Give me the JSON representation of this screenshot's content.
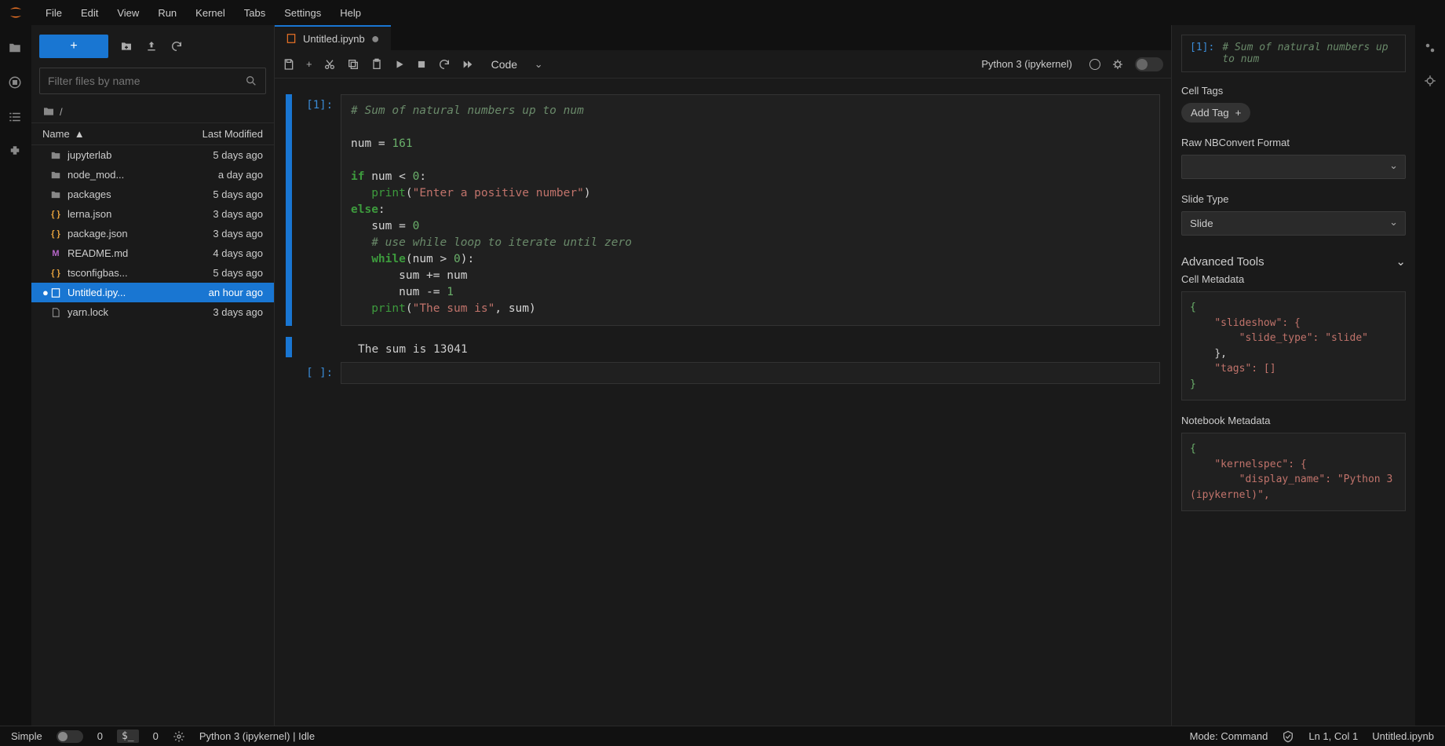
{
  "menubar": [
    "File",
    "Edit",
    "View",
    "Run",
    "Kernel",
    "Tabs",
    "Settings",
    "Help"
  ],
  "filter_placeholder": "Filter files by name",
  "breadcrumb_root": "/",
  "file_header": {
    "name": "Name",
    "modified": "Last Modified"
  },
  "files": [
    {
      "icon": "folder",
      "name": "jupyterlab",
      "modified": "5 days ago"
    },
    {
      "icon": "folder",
      "name": "node_mod...",
      "modified": "a day ago"
    },
    {
      "icon": "folder",
      "name": "packages",
      "modified": "5 days ago"
    },
    {
      "icon": "json",
      "name": "lerna.json",
      "modified": "3 days ago"
    },
    {
      "icon": "json",
      "name": "package.json",
      "modified": "3 days ago"
    },
    {
      "icon": "md",
      "name": "README.md",
      "modified": "4 days ago"
    },
    {
      "icon": "json",
      "name": "tsconfigbas...",
      "modified": "5 days ago"
    },
    {
      "icon": "nb",
      "name": "Untitled.ipy...",
      "modified": "an hour ago",
      "selected": true,
      "dirty": true
    },
    {
      "icon": "file",
      "name": "yarn.lock",
      "modified": "3 days ago"
    }
  ],
  "tab": {
    "title": "Untitled.ipynb"
  },
  "celltype": "Code",
  "kernel": "Python 3 (ipykernel)",
  "cells": {
    "c1_prompt": "[1]:",
    "c1_output": "The sum is 13041",
    "c2_prompt": "[ ]:"
  },
  "code": {
    "l1": "# Sum of natural numbers up to num",
    "l2_var": "num ",
    "l2_op": "= ",
    "l2_num": "161",
    "l3_if": "if",
    "l3_cond": " num ",
    "l3_op": "<",
    "l3_sp": " ",
    "l3_zero": "0",
    "l3_colon": ":",
    "l4_indent": "   ",
    "l4_print": "print",
    "l4_paren": "(",
    "l4_str": "\"Enter a positive number\"",
    "l4_close": ")",
    "l5_else": "else",
    "l5_colon": ":",
    "l6_indent": "   ",
    "l6_sum": "sum ",
    "l6_op": "= ",
    "l6_zero": "0",
    "l7_indent": "   ",
    "l7_comment": "# use while loop to iterate until zero",
    "l8_indent": "   ",
    "l8_while": "while",
    "l8_paren": "(num ",
    "l8_op": ">",
    "l8_sp": " ",
    "l8_zero": "0",
    "l8_close": "):",
    "l9_indent": "       ",
    "l9_sum": "sum ",
    "l9_op": "+= ",
    "l9_var": "num",
    "l10_indent": "       ",
    "l10_num": "num ",
    "l10_op": "-= ",
    "l10_one": "1",
    "l11_indent": "   ",
    "l11_print": "print",
    "l11_paren": "(",
    "l11_str": "\"The sum is\"",
    "l11_comma": ", sum)"
  },
  "right": {
    "preview_prompt": "[1]:",
    "preview_text": "# Sum of natural numbers up to num",
    "cell_tags_label": "Cell Tags",
    "add_tag": "Add Tag",
    "raw_label": "Raw NBConvert Format",
    "raw_value": "",
    "slide_label": "Slide Type",
    "slide_value": "Slide",
    "adv_label": "Advanced Tools",
    "cell_meta_label": "Cell Metadata",
    "nb_meta_label": "Notebook Metadata"
  },
  "cell_metadata_json": {
    "open": "{",
    "l1": "    \"slideshow\": {",
    "l2": "        \"slide_type\": \"slide\"",
    "l3": "    },",
    "l4": "    \"tags\": []",
    "close": "}"
  },
  "nb_metadata_json": {
    "open": "{",
    "l1": "    \"kernelspec\": {",
    "l2": "        \"display_name\": \"Python 3 (ipykernel)\","
  },
  "statusbar": {
    "simple": "Simple",
    "count1": "0",
    "count2": "0",
    "kernel_status": "Python 3 (ipykernel) | Idle",
    "mode": "Mode: Command",
    "cursor": "Ln 1, Col 1",
    "file": "Untitled.ipynb"
  }
}
